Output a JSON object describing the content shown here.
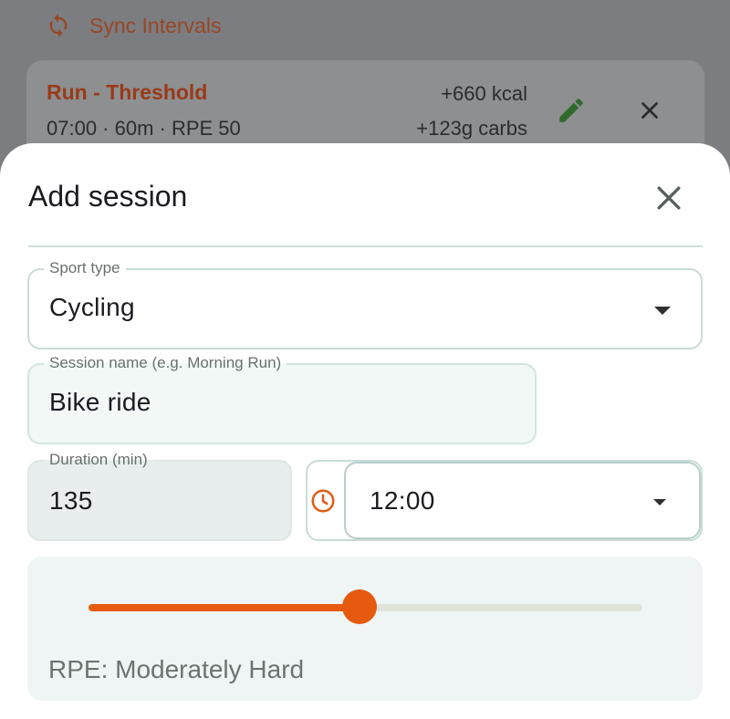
{
  "background": {
    "sync_label": "Sync Intervals",
    "card": {
      "title": "Run - Threshold",
      "subtitle": "07:00 · 60m · RPE 50",
      "kcal": "+660 kcal",
      "carbs": "+123g carbs"
    }
  },
  "sheet": {
    "title": "Add session",
    "sport_type": {
      "label": "Sport type",
      "value": "Cycling"
    },
    "session_name": {
      "label": "Session name (e.g. Morning Run)",
      "value": "Bike ride"
    },
    "duration": {
      "label": "Duration (min)",
      "value": "135"
    },
    "start_time": {
      "value": "12:00"
    },
    "rpe": {
      "label": "RPE: Moderately Hard",
      "level": 0.49
    }
  },
  "colors": {
    "accent": "#e85b12",
    "edit_green": "#2e6b2a"
  },
  "icons": [
    "sync-icon",
    "edit-icon",
    "close-icon",
    "clock-icon",
    "dropdown-arrow-icon"
  ]
}
